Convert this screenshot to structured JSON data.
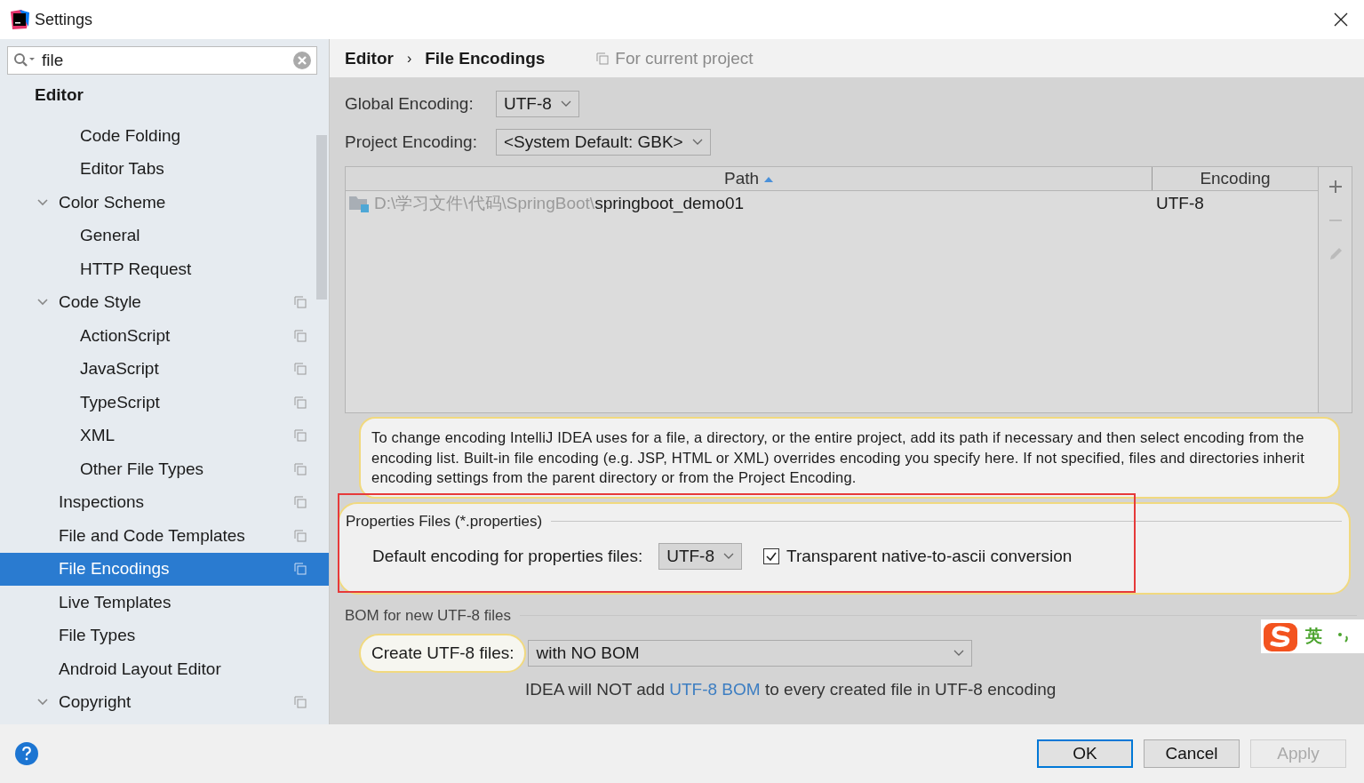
{
  "window": {
    "title": "Settings"
  },
  "search": {
    "value": "file"
  },
  "sidebar": {
    "header": "Editor",
    "group_tail": [
      {
        "label": "Code Folding",
        "project": false,
        "selected": false
      },
      {
        "label": "Editor Tabs",
        "project": false,
        "selected": false
      }
    ],
    "items": [
      {
        "label": "Color Scheme",
        "expanded": true,
        "project": false,
        "selected": false,
        "children": [
          {
            "label": "General",
            "project": false,
            "selected": false
          },
          {
            "label": "HTTP Request",
            "project": false,
            "selected": false
          }
        ]
      },
      {
        "label": "Code Style",
        "expanded": true,
        "project": true,
        "selected": false,
        "children": [
          {
            "label": "ActionScript",
            "project": true,
            "selected": false
          },
          {
            "label": "JavaScript",
            "project": true,
            "selected": false
          },
          {
            "label": "TypeScript",
            "project": true,
            "selected": false
          },
          {
            "label": "XML",
            "project": true,
            "selected": false
          },
          {
            "label": "Other File Types",
            "project": true,
            "selected": false
          }
        ]
      },
      {
        "label": "Inspections",
        "project": true,
        "selected": false
      },
      {
        "label": "File and Code Templates",
        "project": true,
        "selected": false
      },
      {
        "label": "File Encodings",
        "project": true,
        "selected": true
      },
      {
        "label": "Live Templates",
        "project": false,
        "selected": false
      },
      {
        "label": "File Types",
        "project": false,
        "selected": false
      },
      {
        "label": "Android Layout Editor",
        "project": false,
        "selected": false
      },
      {
        "label": "Copyright",
        "expanded": true,
        "project": true,
        "selected": false
      }
    ]
  },
  "breadcrumb": {
    "parent": "Editor",
    "separator": "›",
    "current": "File Encodings",
    "scope": "For current project"
  },
  "global_encoding": {
    "label": "Global Encoding:",
    "value": "UTF-8"
  },
  "project_encoding": {
    "label": "Project Encoding:",
    "value": "<System Default: GBK>"
  },
  "table": {
    "columns": [
      "Path",
      "Encoding"
    ],
    "rows": [
      {
        "path_prefix": "D:\\学习文件\\代码\\SpringBoot\\",
        "path_name": "springboot_demo01",
        "encoding": "UTF-8"
      }
    ]
  },
  "info": "To change encoding IntelliJ IDEA uses for a file, a directory, or the entire project, add its path if necessary and then select encoding from the encoding list. Built-in file encoding (e.g. JSP, HTML or XML) overrides encoding you specify here. If not specified, files and directories inherit encoding settings from the parent directory or from the Project Encoding.",
  "properties": {
    "title": "Properties Files (*.properties)",
    "label": "Default encoding for properties files:",
    "value": "UTF-8",
    "transparent_label": "Transparent native-to-ascii conversion",
    "transparent_checked": true
  },
  "bom": {
    "title": "BOM for new UTF-8 files",
    "label": "Create UTF-8 files:",
    "value": "with NO BOM",
    "note_before": "IDEA will NOT add ",
    "note_link": "UTF-8 BOM",
    "note_after": " to every created file in UTF-8 encoding"
  },
  "ime": {
    "mode": "英"
  },
  "buttons": [
    {
      "label": "OK",
      "kind": "default",
      "disabled": false
    },
    {
      "label": "Cancel",
      "kind": "normal",
      "disabled": false
    },
    {
      "label": "Apply",
      "kind": "normal",
      "disabled": true
    }
  ]
}
